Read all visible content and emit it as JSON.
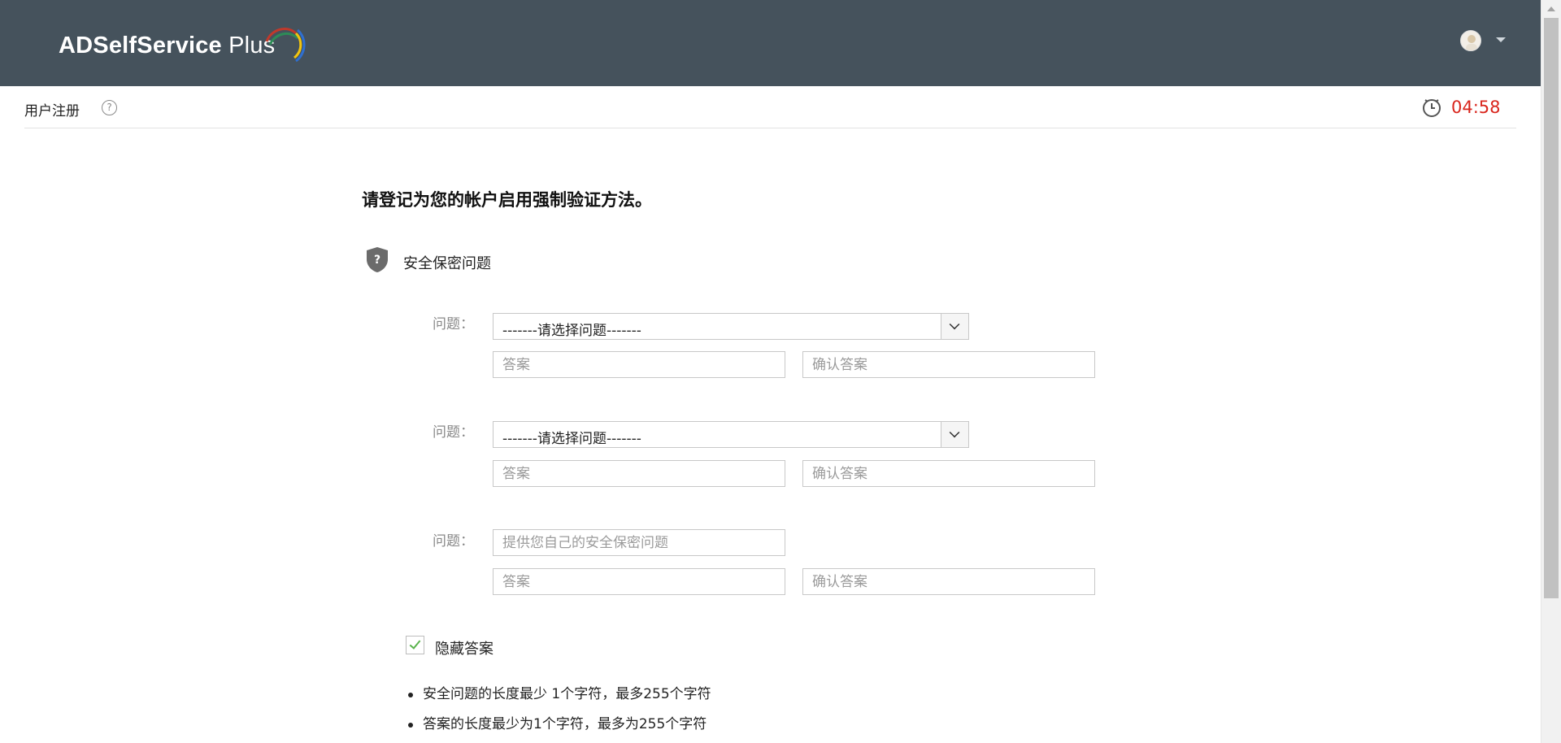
{
  "header": {
    "app_name": "ADSelfService",
    "app_name_suffix": "Plus",
    "account_menu_icon": "user-avatar",
    "account_menu_caret_icon": "caret-down-icon"
  },
  "subbar": {
    "page_title": "用户注册",
    "help_icon": "question-circle-icon",
    "timer_icon": "clock-icon",
    "timer": "04:58"
  },
  "main": {
    "heading": "请登记为您的帐户启用强制验证方法。",
    "section": {
      "icon": "shield-question-icon",
      "title": "安全保密问题"
    },
    "questions": [
      {
        "label": "问题：",
        "select_value": "-------请选择问题-------",
        "answer_placeholder": "答案",
        "confirm_placeholder": "确认答案"
      },
      {
        "label": "问题：",
        "select_value": "-------请选择问题-------",
        "answer_placeholder": "答案",
        "confirm_placeholder": "确认答案"
      },
      {
        "label": "问题：",
        "custom_placeholder": "提供您自己的安全保密问题",
        "answer_placeholder": "答案",
        "confirm_placeholder": "确认答案"
      }
    ],
    "hide_answers": {
      "label": "隐藏答案",
      "checked": true
    },
    "rules": [
      "安全问题的长度最少 1个字符，最多255个字符",
      "答案的长度最少为1个字符，最多为255个字符"
    ]
  },
  "colors": {
    "header_bg": "#45525c",
    "timer": "#d9251c",
    "check": "#59b34c"
  }
}
